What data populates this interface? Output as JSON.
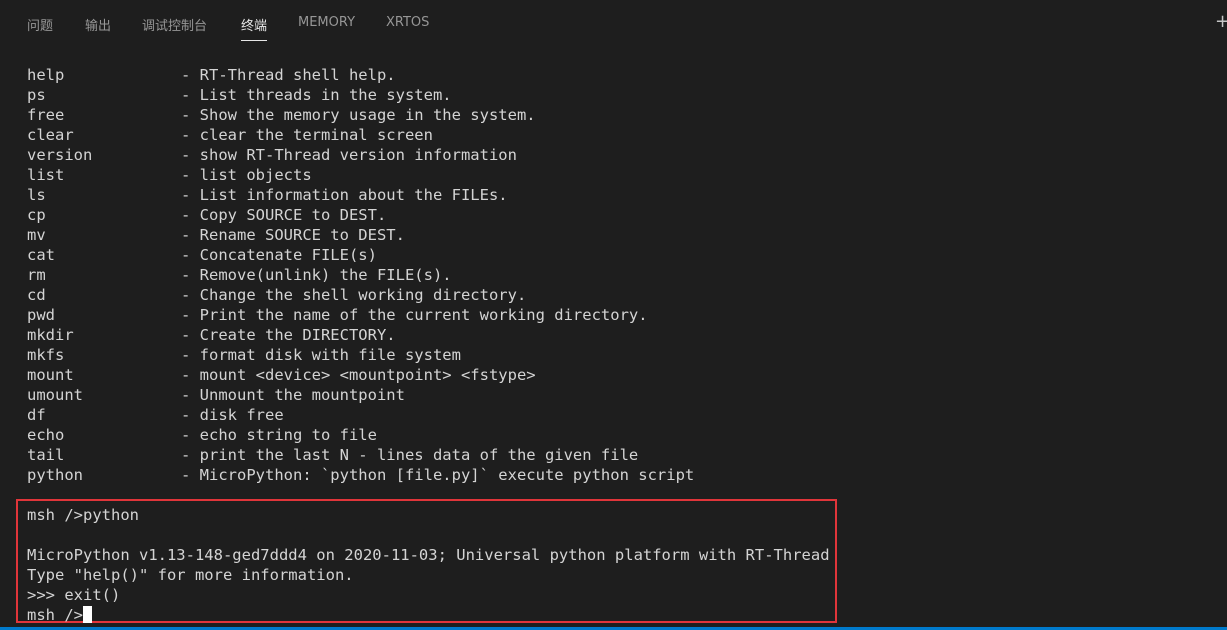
{
  "tabs": [
    {
      "label": "问题"
    },
    {
      "label": "输出"
    },
    {
      "label": "调试控制台"
    },
    {
      "label": "终端"
    },
    {
      "label": "MEMORY"
    },
    {
      "label": "XRTOS"
    }
  ],
  "active_tab": "终端",
  "help_rows": [
    {
      "cmd": "help",
      "desc": "- RT-Thread shell help."
    },
    {
      "cmd": "ps",
      "desc": "- List threads in the system."
    },
    {
      "cmd": "free",
      "desc": "- Show the memory usage in the system."
    },
    {
      "cmd": "clear",
      "desc": "- clear the terminal screen"
    },
    {
      "cmd": "version",
      "desc": "- show RT-Thread version information"
    },
    {
      "cmd": "list",
      "desc": "- list objects"
    },
    {
      "cmd": "ls",
      "desc": "- List information about the FILEs."
    },
    {
      "cmd": "cp",
      "desc": "- Copy SOURCE to DEST."
    },
    {
      "cmd": "mv",
      "desc": "- Rename SOURCE to DEST."
    },
    {
      "cmd": "cat",
      "desc": "- Concatenate FILE(s)"
    },
    {
      "cmd": "rm",
      "desc": "- Remove(unlink) the FILE(s)."
    },
    {
      "cmd": "cd",
      "desc": "- Change the shell working directory."
    },
    {
      "cmd": "pwd",
      "desc": "- Print the name of the current working directory."
    },
    {
      "cmd": "mkdir",
      "desc": "- Create the DIRECTORY."
    },
    {
      "cmd": "mkfs",
      "desc": "- format disk with file system"
    },
    {
      "cmd": "mount",
      "desc": "- mount <device> <mountpoint> <fstype>"
    },
    {
      "cmd": "umount",
      "desc": "- Unmount the mountpoint"
    },
    {
      "cmd": "df",
      "desc": "- disk free"
    },
    {
      "cmd": "echo",
      "desc": "- echo string to file"
    },
    {
      "cmd": "tail",
      "desc": "- print the last N - lines data of the given file"
    },
    {
      "cmd": "python",
      "desc": "- MicroPython: `python [file.py]` execute python script"
    }
  ],
  "session": {
    "prompt_cmd": "msh />python",
    "blank": "",
    "banner": "MicroPython v1.13-148-ged7ddd4 on 2020-11-03; Universal python platform with RT-Thread",
    "info": "Type \"help()\" for more information.",
    "repl_line": ">>> exit()",
    "final_prompt": "msh />"
  },
  "icons": {
    "new_terminal": "plus-icon"
  },
  "colors": {
    "background": "#1e1e1e",
    "text": "#d4d4d4",
    "highlight_border": "#e0353a",
    "statusbar": "#007acc"
  }
}
